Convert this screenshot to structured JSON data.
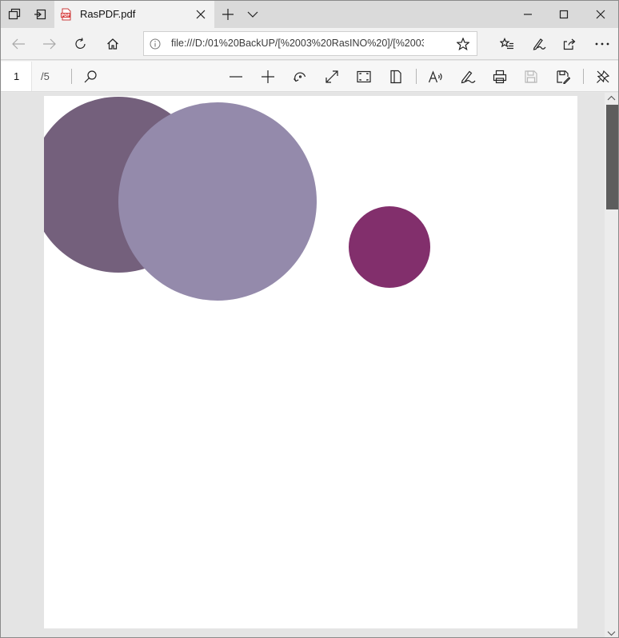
{
  "tab": {
    "title": "RasPDF.pdf",
    "icon": "pdf-file-icon"
  },
  "address": {
    "url": "file:///D:/01%20BackUP/[%2003%20RasINO%20]/[%2003%20",
    "info_icon": "info-icon"
  },
  "pdf_toolbar": {
    "page_number": "1",
    "page_total": "/5"
  },
  "colors": {
    "titlebar": "#dadada",
    "circle_dark": "#74607c",
    "circle_light": "#948aab",
    "circle_small": "#822f6c"
  },
  "document": {
    "shapes": [
      {
        "name": "dark-mauve-circle",
        "color": "#74607c"
      },
      {
        "name": "light-lavender-circle",
        "color": "#948aab"
      },
      {
        "name": "small-plum-circle",
        "color": "#822f6c"
      }
    ]
  }
}
